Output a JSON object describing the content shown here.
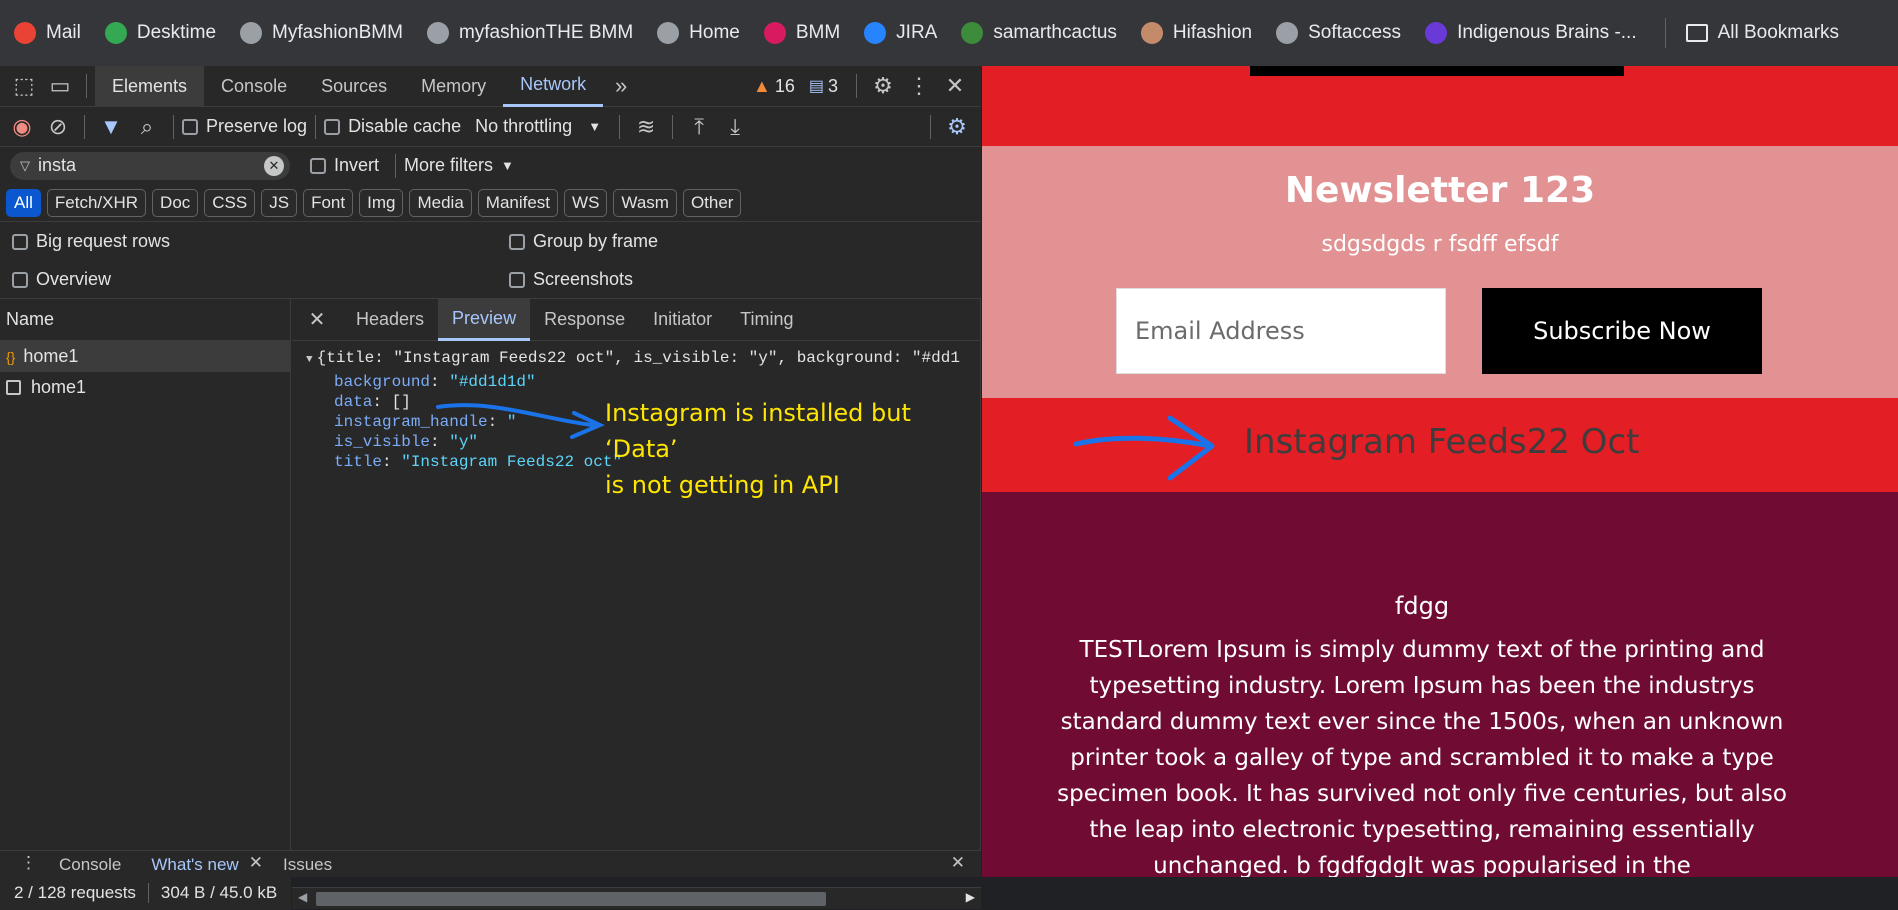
{
  "bookmarks": [
    {
      "label": "Mail",
      "icon": "gmail-icon",
      "color": "#ea4335"
    },
    {
      "label": "Desktime",
      "icon": "desktime-icon",
      "color": "#34a853"
    },
    {
      "label": "MyfashionBMM",
      "icon": "globe-icon",
      "color": "#9aa0a6"
    },
    {
      "label": "myfashionTHE BMM",
      "icon": "globe-icon",
      "color": "#9aa0a6"
    },
    {
      "label": "Home",
      "icon": "globe-icon",
      "color": "#9aa0a6"
    },
    {
      "label": "BMM",
      "icon": "bmm-icon",
      "color": "#d81b60"
    },
    {
      "label": "JIRA",
      "icon": "jira-icon",
      "color": "#2684ff"
    },
    {
      "label": "samarthcactus",
      "icon": "cactus-icon",
      "color": "#3c8c3c"
    },
    {
      "label": "Hifashion",
      "icon": "hifashion-icon",
      "color": "#c48b6a"
    },
    {
      "label": "Softaccess",
      "icon": "globe-icon",
      "color": "#9aa0a6"
    },
    {
      "label": "Indigenous Brains -...",
      "icon": "indigenous-icon",
      "color": "#6a3ad8"
    }
  ],
  "all_bookmarks": "All Bookmarks",
  "devtools": {
    "tabs": [
      "Elements",
      "Console",
      "Sources",
      "Memory",
      "Network"
    ],
    "warnings": "16",
    "messages": "3",
    "preserve_log": "Preserve log",
    "disable_cache": "Disable cache",
    "throttling": "No throttling",
    "filter_value": "insta",
    "invert": "Invert",
    "more_filters": "More filters",
    "type_filters": [
      "All",
      "Fetch/XHR",
      "Doc",
      "CSS",
      "JS",
      "Font",
      "Img",
      "Media",
      "Manifest",
      "WS",
      "Wasm",
      "Other"
    ],
    "big_request_rows": "Big request rows",
    "group_by_frame": "Group by frame",
    "overview": "Overview",
    "screenshots": "Screenshots",
    "name_header": "Name",
    "requests": [
      "home1",
      "home1"
    ],
    "detail_tabs": [
      "Headers",
      "Preview",
      "Response",
      "Initiator",
      "Timing"
    ],
    "preview_summary": "{title: \"Instagram Feeds22 oct\", is_visible: \"y\", background: \"#dd1",
    "preview_props": [
      {
        "key": "background",
        "value": "\"#dd1d1d\""
      },
      {
        "key": "data",
        "value": "[]"
      },
      {
        "key": "instagram_handle",
        "value": "\""
      },
      {
        "key": "is_visible",
        "value": "\"y\""
      },
      {
        "key": "title",
        "value": "\"Instagram Feeds22 oct\""
      }
    ],
    "annotation_line1": "Instagram is installed but ‘Data’",
    "annotation_line2": "is not getting in API",
    "status_requests": "2 / 128 requests",
    "status_size": "304 B / 45.0 kB",
    "drawer_tabs": [
      "Console",
      "What's new",
      "Issues"
    ]
  },
  "page": {
    "newsletter_title": "Newsletter 123",
    "newsletter_subtitle": "sdgsdgds r fsdff efsdf",
    "email_placeholder": "Email Address",
    "subscribe_label": "Subscribe Now",
    "instagram_title": "Instagram Feeds22 Oct",
    "section_heading": "fdgg",
    "section_text": "TESTLorem Ipsum is simply dummy text of the printing and typesetting industry. Lorem Ipsum has been the industrys standard dummy text ever since the 1500s, when an unknown printer took a galley of type and scrambled it to make a type specimen book. It has survived not only five centuries, but also the leap into electronic typesetting, remaining essentially unchanged. b fgdfgdgIt was popularised in the",
    "colors": {
      "red": "#e31e24",
      "pink": "#e29293",
      "maroon": "#700c33",
      "annotation": "#ffe600",
      "arrow": "#1a73e8"
    }
  }
}
